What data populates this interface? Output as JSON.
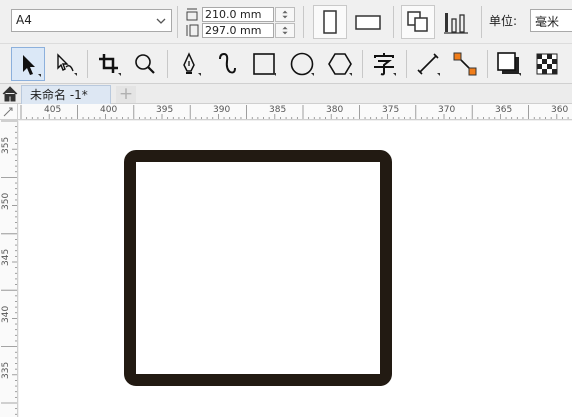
{
  "property_bar": {
    "page_size": "A4",
    "width": "210.0 mm",
    "height": "297.0 mm",
    "units_label": "单位:",
    "units_value": "毫米"
  },
  "toolbox": {
    "tools": [
      "pick-tool",
      "shape-tool",
      "crop-tool",
      "zoom-tool",
      "pen-tool",
      "artistic-media-tool",
      "rectangle-tool",
      "ellipse-tool",
      "polygon-tool",
      "text-tool",
      "dimension-tool",
      "connector-tool",
      "drop-shadow-tool",
      "transparency-tool"
    ]
  },
  "tabs": {
    "document_title": "未命名 -1*",
    "add_label": "+"
  },
  "rulers": {
    "horizontal": [
      "405",
      "400",
      "395",
      "390",
      "385",
      "380",
      "375",
      "370",
      "365",
      "360"
    ],
    "vertical": [
      "355",
      "350",
      "345",
      "340",
      "335"
    ]
  },
  "colors": {
    "frame_stroke": "#221a12",
    "accent_orange": "#f07d1a"
  }
}
